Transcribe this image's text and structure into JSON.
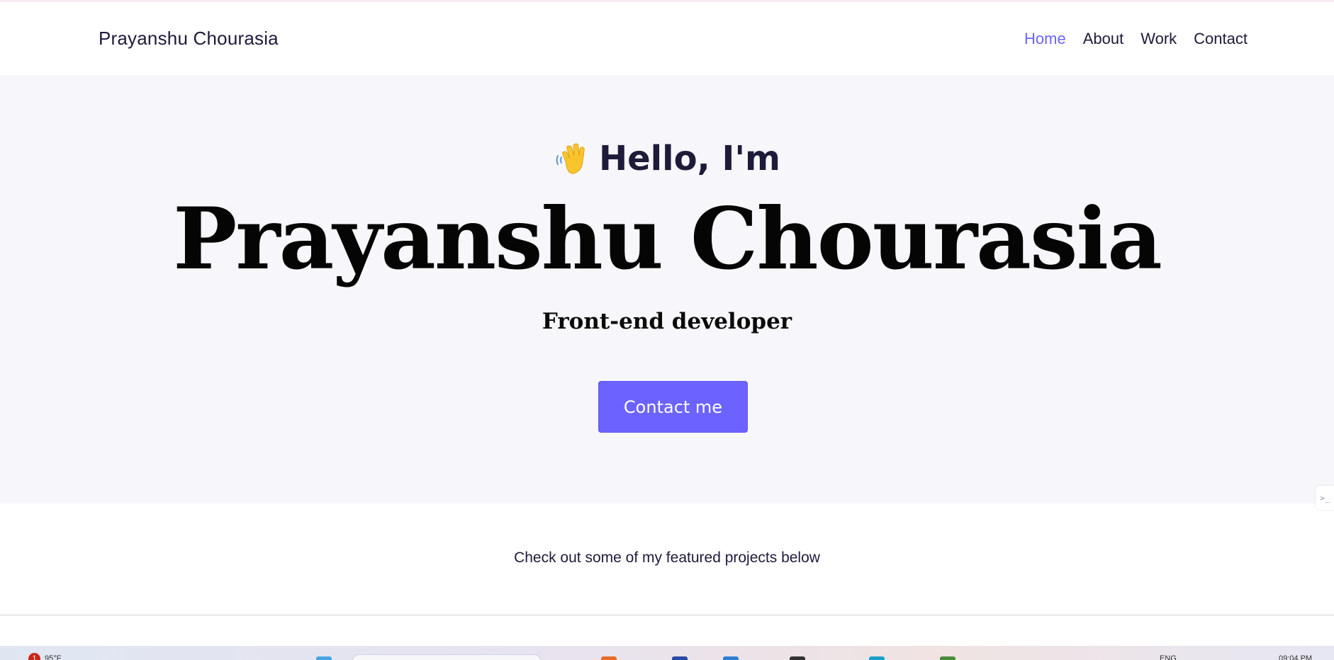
{
  "navbar": {
    "brand": "Prayanshu Chourasia",
    "links": [
      {
        "label": "Home",
        "active": true
      },
      {
        "label": "About",
        "active": false
      },
      {
        "label": "Work",
        "active": false
      },
      {
        "label": "Contact",
        "active": false
      }
    ]
  },
  "hero": {
    "wave_icon": "waving-hand-icon",
    "greeting": "Hello, I'm",
    "name": "Prayanshu Chourasia",
    "role": "Front-end developer",
    "cta_label": "Contact me"
  },
  "projects": {
    "intro": "Check out some of my featured projects below"
  },
  "colors": {
    "accent": "#6c63ff",
    "hero_background": "#f7f7fb",
    "text_dark": "#1e1b3a"
  },
  "taskbar": {
    "notification_count": "1",
    "weather": "95°F",
    "language": "ENG",
    "time": "09:04 PM"
  }
}
